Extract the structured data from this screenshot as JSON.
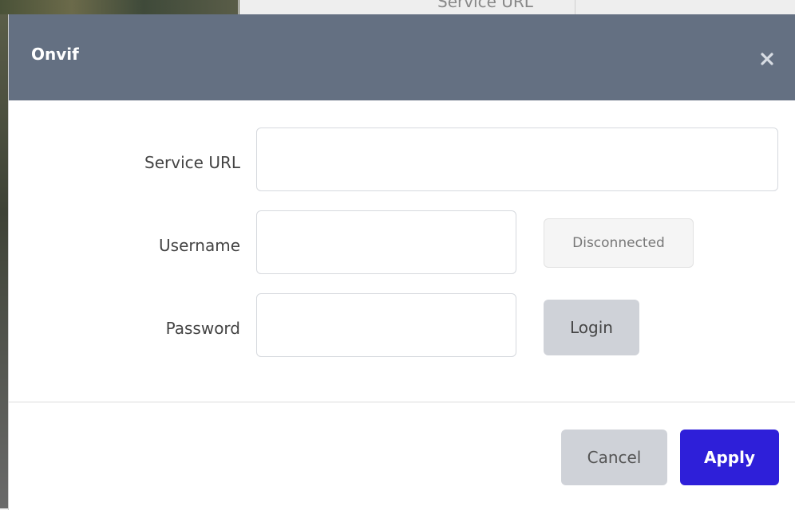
{
  "background": {
    "partial_text": "Service URL"
  },
  "dialog": {
    "title": "Onvif",
    "close_icon": "close-x-icon",
    "fields": {
      "service_url": {
        "label": "Service URL",
        "value": "",
        "placeholder": ""
      },
      "username": {
        "label": "Username",
        "value": "",
        "placeholder": ""
      },
      "password": {
        "label": "Password",
        "value": "",
        "placeholder": ""
      }
    },
    "status": "Disconnected",
    "login_label": "Login",
    "cancel_label": "Cancel",
    "apply_label": "Apply"
  },
  "colors": {
    "header_bg": "#647082",
    "primary_button": "#2e1fd9",
    "secondary_button": "#cfd2d8"
  }
}
